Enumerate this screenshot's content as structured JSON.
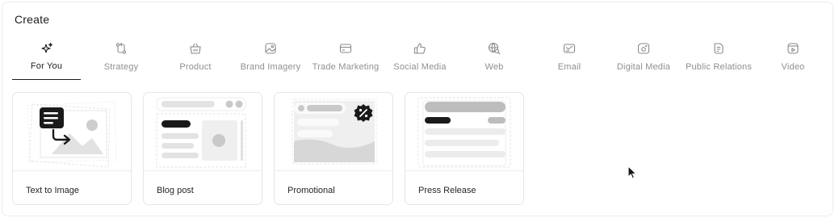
{
  "header": {
    "title": "Create"
  },
  "tabs": [
    {
      "label": "For You",
      "icon": "sparkles-icon",
      "active": true
    },
    {
      "label": "Strategy",
      "icon": "route-icon",
      "active": false
    },
    {
      "label": "Product",
      "icon": "basket-icon",
      "active": false
    },
    {
      "label": "Brand Imagery",
      "icon": "image-icon",
      "active": false
    },
    {
      "label": "Trade Marketing",
      "icon": "card-icon",
      "active": false
    },
    {
      "label": "Social Media",
      "icon": "thumbs-up-icon",
      "active": false
    },
    {
      "label": "Web",
      "icon": "globe-search-icon",
      "active": false
    },
    {
      "label": "Email",
      "icon": "mail-icon",
      "active": false
    },
    {
      "label": "Digital Media",
      "icon": "digital-media-icon",
      "active": false
    },
    {
      "label": "Public Relations",
      "icon": "document-icon",
      "active": false
    },
    {
      "label": "Video",
      "icon": "video-icon",
      "active": false
    }
  ],
  "cards": [
    {
      "label": "Text to Image"
    },
    {
      "label": "Blog post"
    },
    {
      "label": "Promotional"
    },
    {
      "label": "Press Release"
    }
  ],
  "colors": {
    "active": "#1a1a1a",
    "inactive": "#8f8f8f",
    "border": "#e6e6e6",
    "placeholder": "#d9d9d9"
  }
}
